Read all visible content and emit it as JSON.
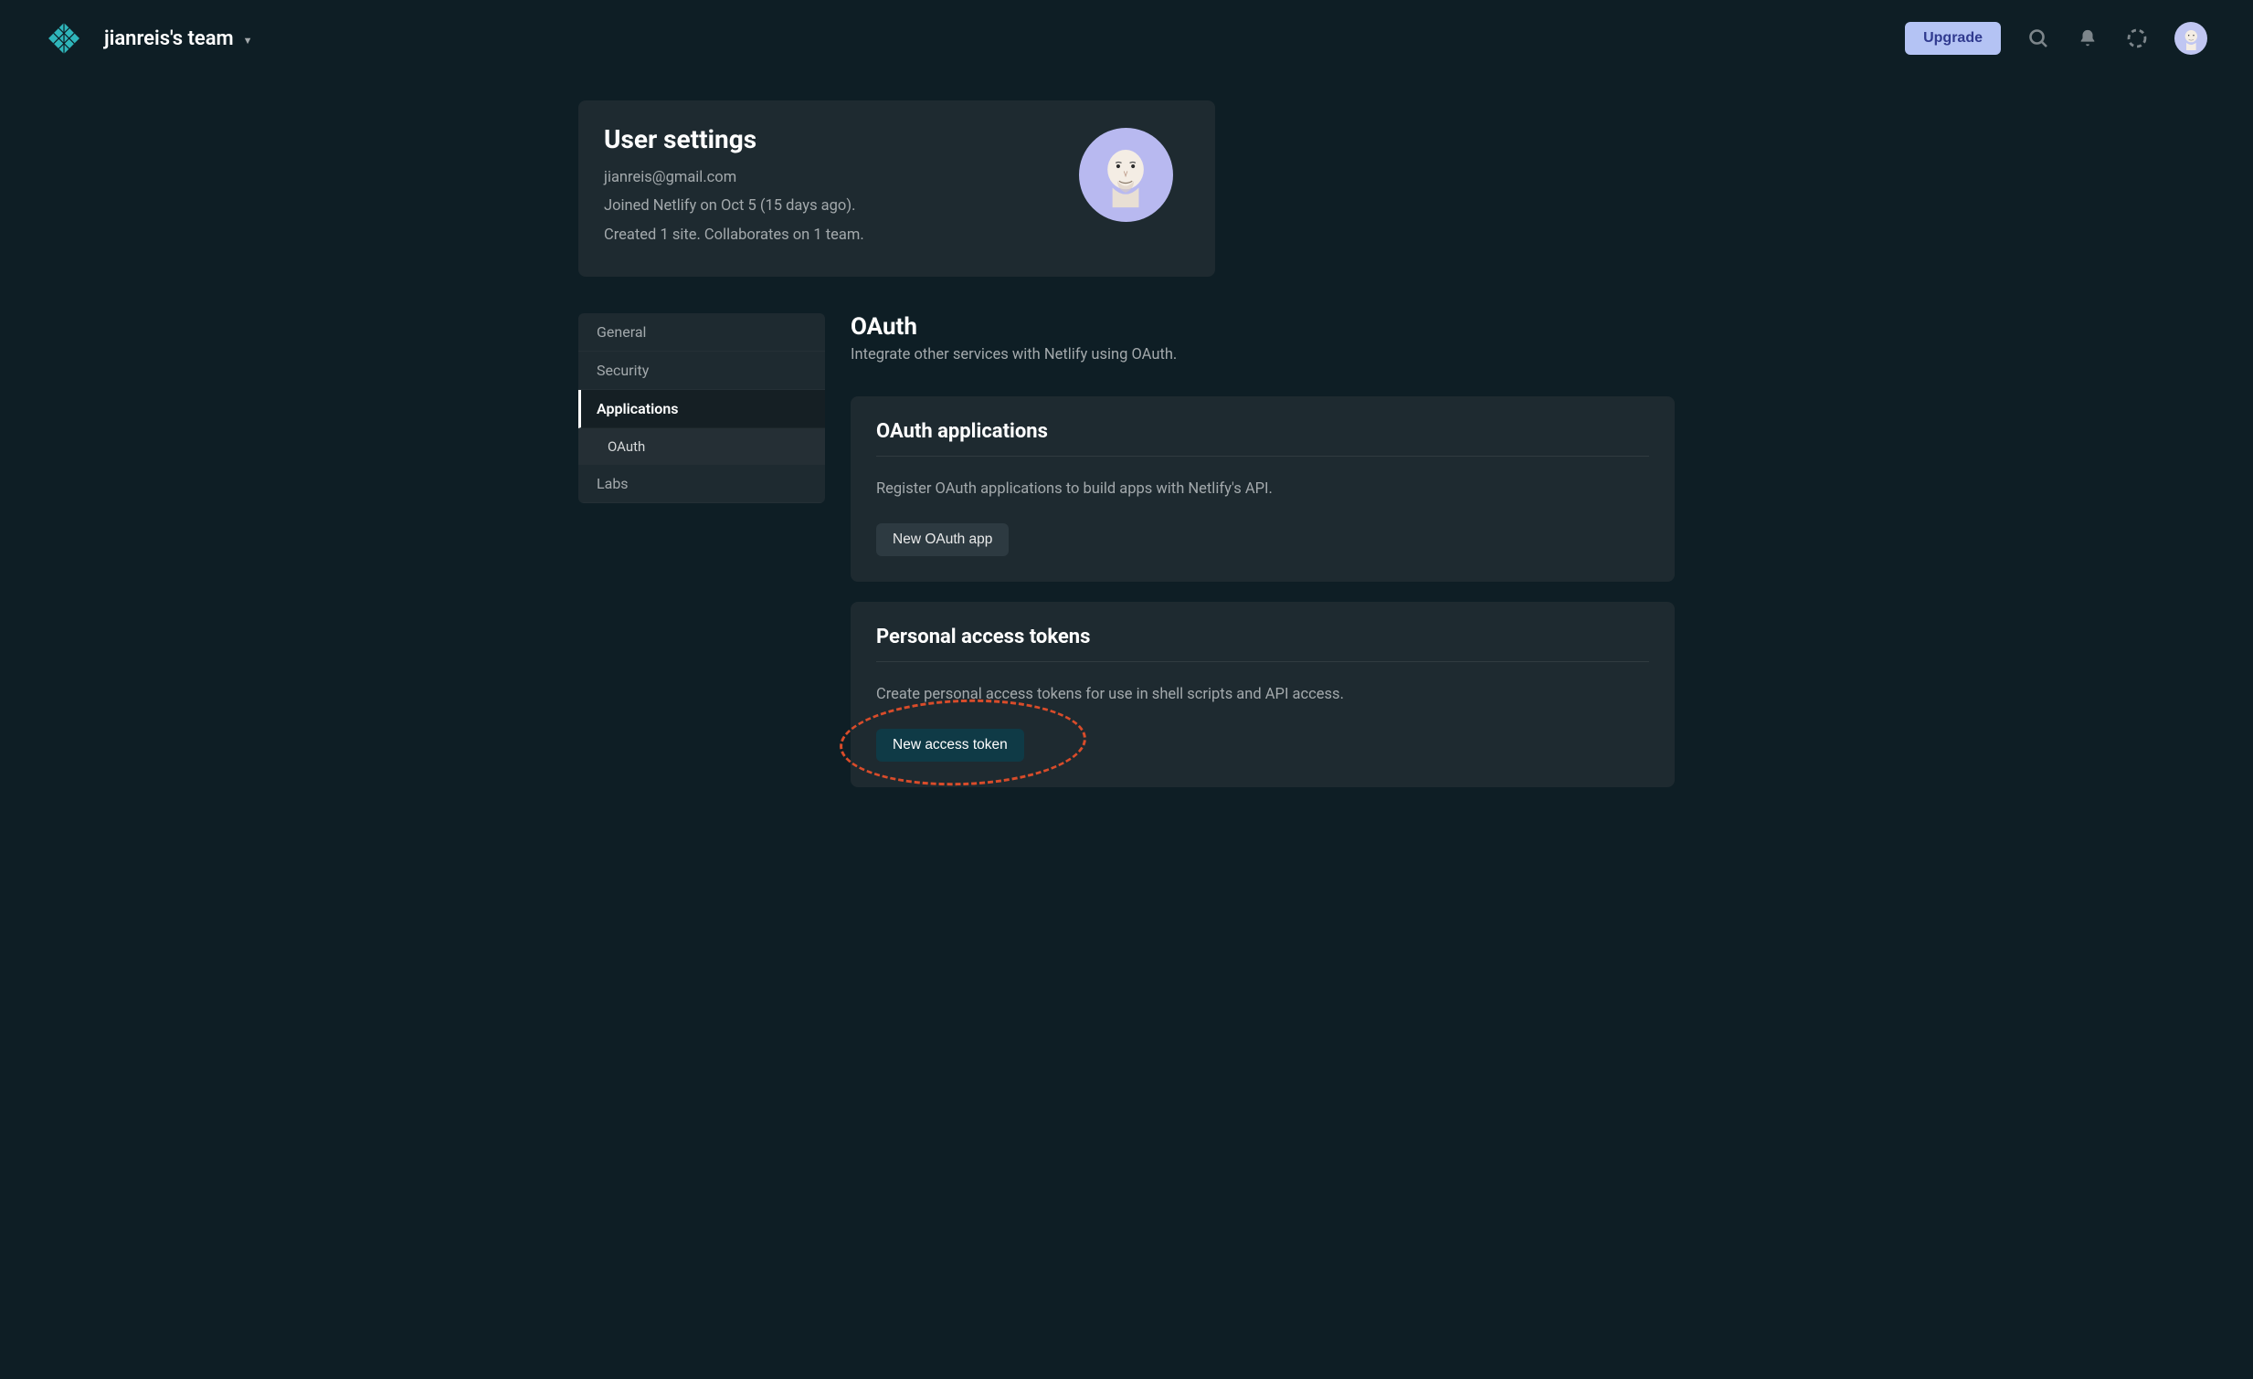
{
  "header": {
    "team_name": "jianreis's team",
    "upgrade_label": "Upgrade"
  },
  "user_card": {
    "title": "User settings",
    "email": "jianreis@gmail.com",
    "joined_line": "Joined Netlify on Oct 5 (15 days ago).",
    "stats_line": "Created 1 site. Collaborates on 1 team."
  },
  "sidebar": {
    "items": [
      {
        "label": "General",
        "active": false
      },
      {
        "label": "Security",
        "active": false
      },
      {
        "label": "Applications",
        "active": true
      },
      {
        "label": "Labs",
        "active": false
      }
    ],
    "subitem_label": "OAuth"
  },
  "content": {
    "section_title": "OAuth",
    "section_desc": "Integrate other services with Netlify using OAuth.",
    "oauth_apps_panel": {
      "title": "OAuth applications",
      "desc": "Register OAuth applications to build apps with Netlify's API.",
      "button_label": "New OAuth app"
    },
    "tokens_panel": {
      "title": "Personal access tokens",
      "desc": "Create personal access tokens for use in shell scripts and API access.",
      "button_label": "New access token"
    }
  }
}
